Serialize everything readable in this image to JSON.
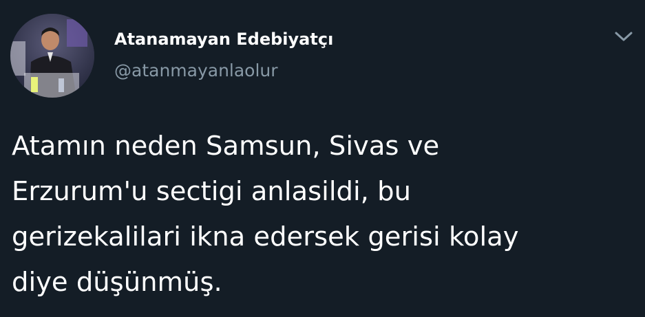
{
  "tweet": {
    "author": {
      "display_name": "Atanamayan Edebiyatçı",
      "handle": "@atanmayanlaolur",
      "avatar": "user-avatar-photo"
    },
    "menu_icon": "chevron-down-icon",
    "text_lines": [
      "Atamın neden Samsun, Sivas ve",
      "Erzurum'u sectigi anlasildi, bu",
      "gerizekalilari ikna edersek gerisi kolay",
      "diye düşünmüş."
    ]
  },
  "colors": {
    "background": "#141d26",
    "text": "#ffffff",
    "secondary_text": "#8899a6"
  }
}
